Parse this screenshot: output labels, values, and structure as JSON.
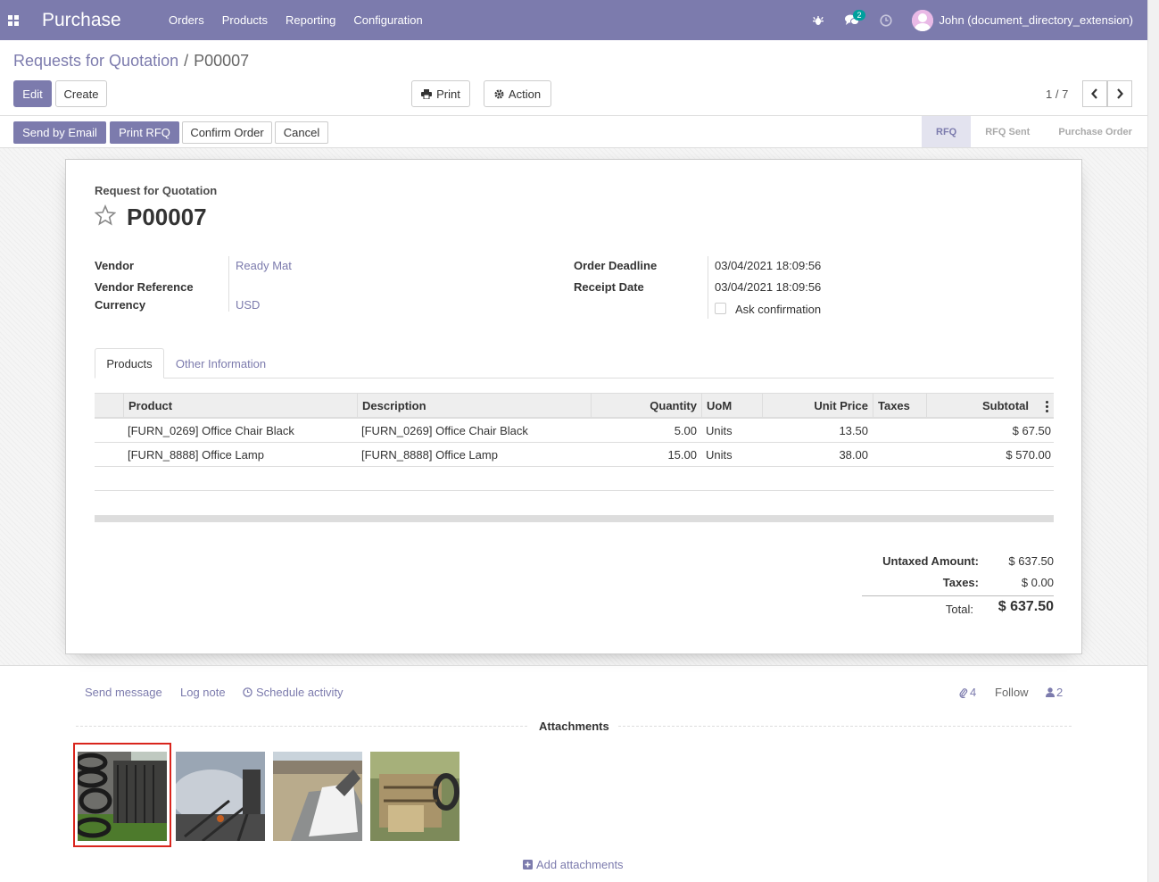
{
  "navbar": {
    "app_title": "Purchase",
    "menu": [
      "Orders",
      "Products",
      "Reporting",
      "Configuration"
    ],
    "message_count": "2",
    "user_name": "John (document_directory_extension)"
  },
  "breadcrumb": {
    "parent": "Requests for Quotation",
    "separator": "/",
    "current": "P00007"
  },
  "toolbar": {
    "edit": "Edit",
    "create": "Create",
    "print": "Print",
    "action": "Action"
  },
  "pager": {
    "text": "1 / 7"
  },
  "statusbar": {
    "buttons": {
      "send_email": "Send by Email",
      "print_rfq": "Print RFQ",
      "confirm": "Confirm Order",
      "cancel": "Cancel"
    },
    "stages": [
      "RFQ",
      "RFQ Sent",
      "Purchase Order"
    ],
    "active_stage": "RFQ"
  },
  "form": {
    "doc_label": "Request for Quotation",
    "name": "P00007",
    "vendor_label": "Vendor",
    "vendor": "Ready Mat",
    "vendor_ref_label": "Vendor Reference",
    "currency_label": "Currency",
    "currency": "USD",
    "deadline_label": "Order Deadline",
    "deadline": "03/04/2021 18:09:56",
    "receipt_label": "Receipt Date",
    "receipt": "03/04/2021 18:09:56",
    "ask_confirmation": "Ask confirmation"
  },
  "tabs": {
    "products": "Products",
    "other": "Other Information"
  },
  "table": {
    "headers": {
      "product": "Product",
      "description": "Description",
      "quantity": "Quantity",
      "uom": "UoM",
      "unit_price": "Unit Price",
      "taxes": "Taxes",
      "subtotal": "Subtotal"
    },
    "rows": [
      {
        "product": "[FURN_0269] Office Chair Black",
        "description": "[FURN_0269] Office Chair Black",
        "quantity": "5.00",
        "uom": "Units",
        "unit_price": "13.50",
        "taxes": "",
        "subtotal": "$ 67.50"
      },
      {
        "product": "[FURN_8888] Office Lamp",
        "description": "[FURN_8888] Office Lamp",
        "quantity": "15.00",
        "uom": "Units",
        "unit_price": "38.00",
        "taxes": "",
        "subtotal": "$ 570.00"
      }
    ]
  },
  "totals": {
    "untaxed_label": "Untaxed Amount:",
    "untaxed": "$ 637.50",
    "taxes_label": "Taxes:",
    "taxes": "$ 0.00",
    "total_label": "Total:",
    "total": "$ 637.50"
  },
  "chatter": {
    "send_message": "Send message",
    "log_note": "Log note",
    "schedule_activity": "Schedule activity",
    "attachment_count": "4",
    "follow": "Follow",
    "follower_count": "2",
    "attachments_title": "Attachments",
    "add_attachments": "Add attachments"
  },
  "colors": {
    "brand": "#7c7bad",
    "badge": "#00a09d",
    "selection": "#d9251d"
  }
}
